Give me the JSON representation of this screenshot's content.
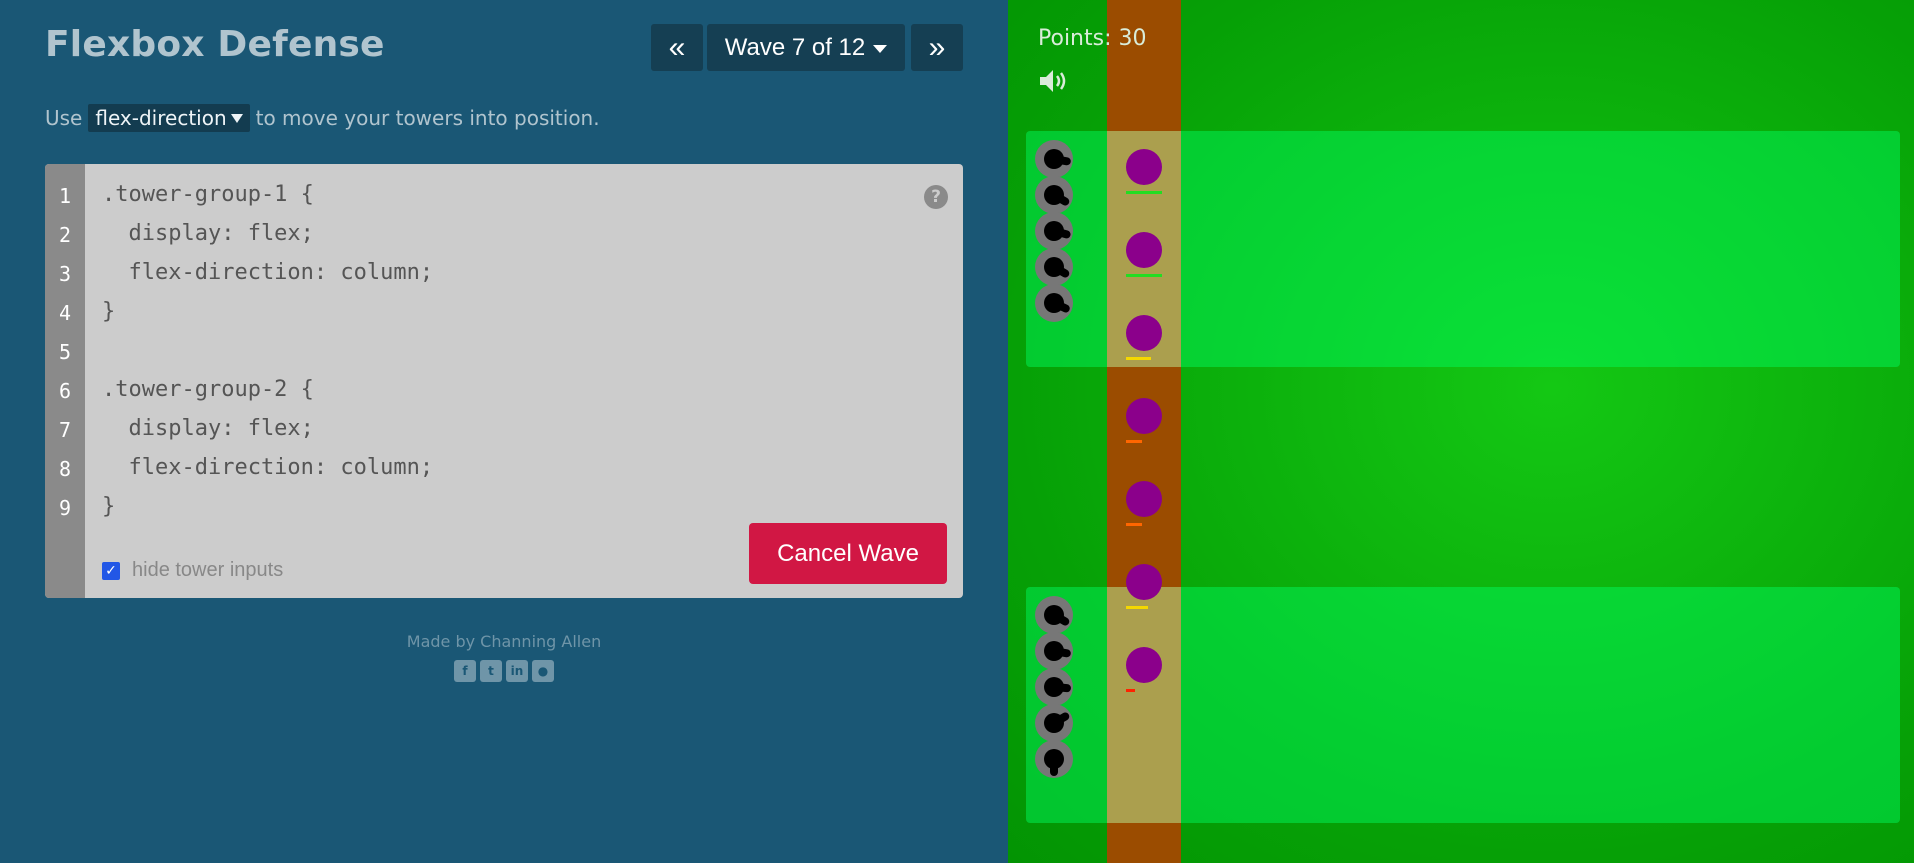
{
  "header": {
    "title": "Flexbox Defense",
    "prev_label": "«",
    "wave_label": "Wave 7 of 12",
    "next_label": "»"
  },
  "instructions": {
    "before": "Use",
    "property": "flex-direction",
    "after": "to move your towers into position."
  },
  "editor": {
    "line_numbers": [
      "1",
      "2",
      "3",
      "4",
      "5",
      "6",
      "7",
      "8",
      "9"
    ],
    "lines": [
      ".tower-group-1 {",
      "  display: flex;",
      "  flex-direction: column;",
      "}",
      "",
      ".tower-group-2 {",
      "  display: flex;",
      "  flex-direction: column;",
      "}"
    ],
    "help_symbol": "?",
    "hide_inputs_label": "hide tower inputs",
    "hide_inputs_checked": true,
    "cancel_label": "Cancel Wave"
  },
  "footer": {
    "credit": "Made by Channing Allen",
    "social_icons": [
      "facebook-icon",
      "twitter-icon",
      "linkedin-icon",
      "github-icon"
    ]
  },
  "game": {
    "points_label": "Points: 30",
    "sound_icon": "speaker-icon",
    "colors": {
      "enemy": "#8b008b",
      "path": "#9b4c00",
      "grass": "#14c814",
      "health_full": "#22dd22",
      "health_mid": "#f5d800",
      "health_low": "#ff6600",
      "health_critical": "#ff2200"
    },
    "enemies_health": [
      1.0,
      1.0,
      0.7,
      0.45,
      0.45,
      0.6,
      0.25
    ]
  }
}
